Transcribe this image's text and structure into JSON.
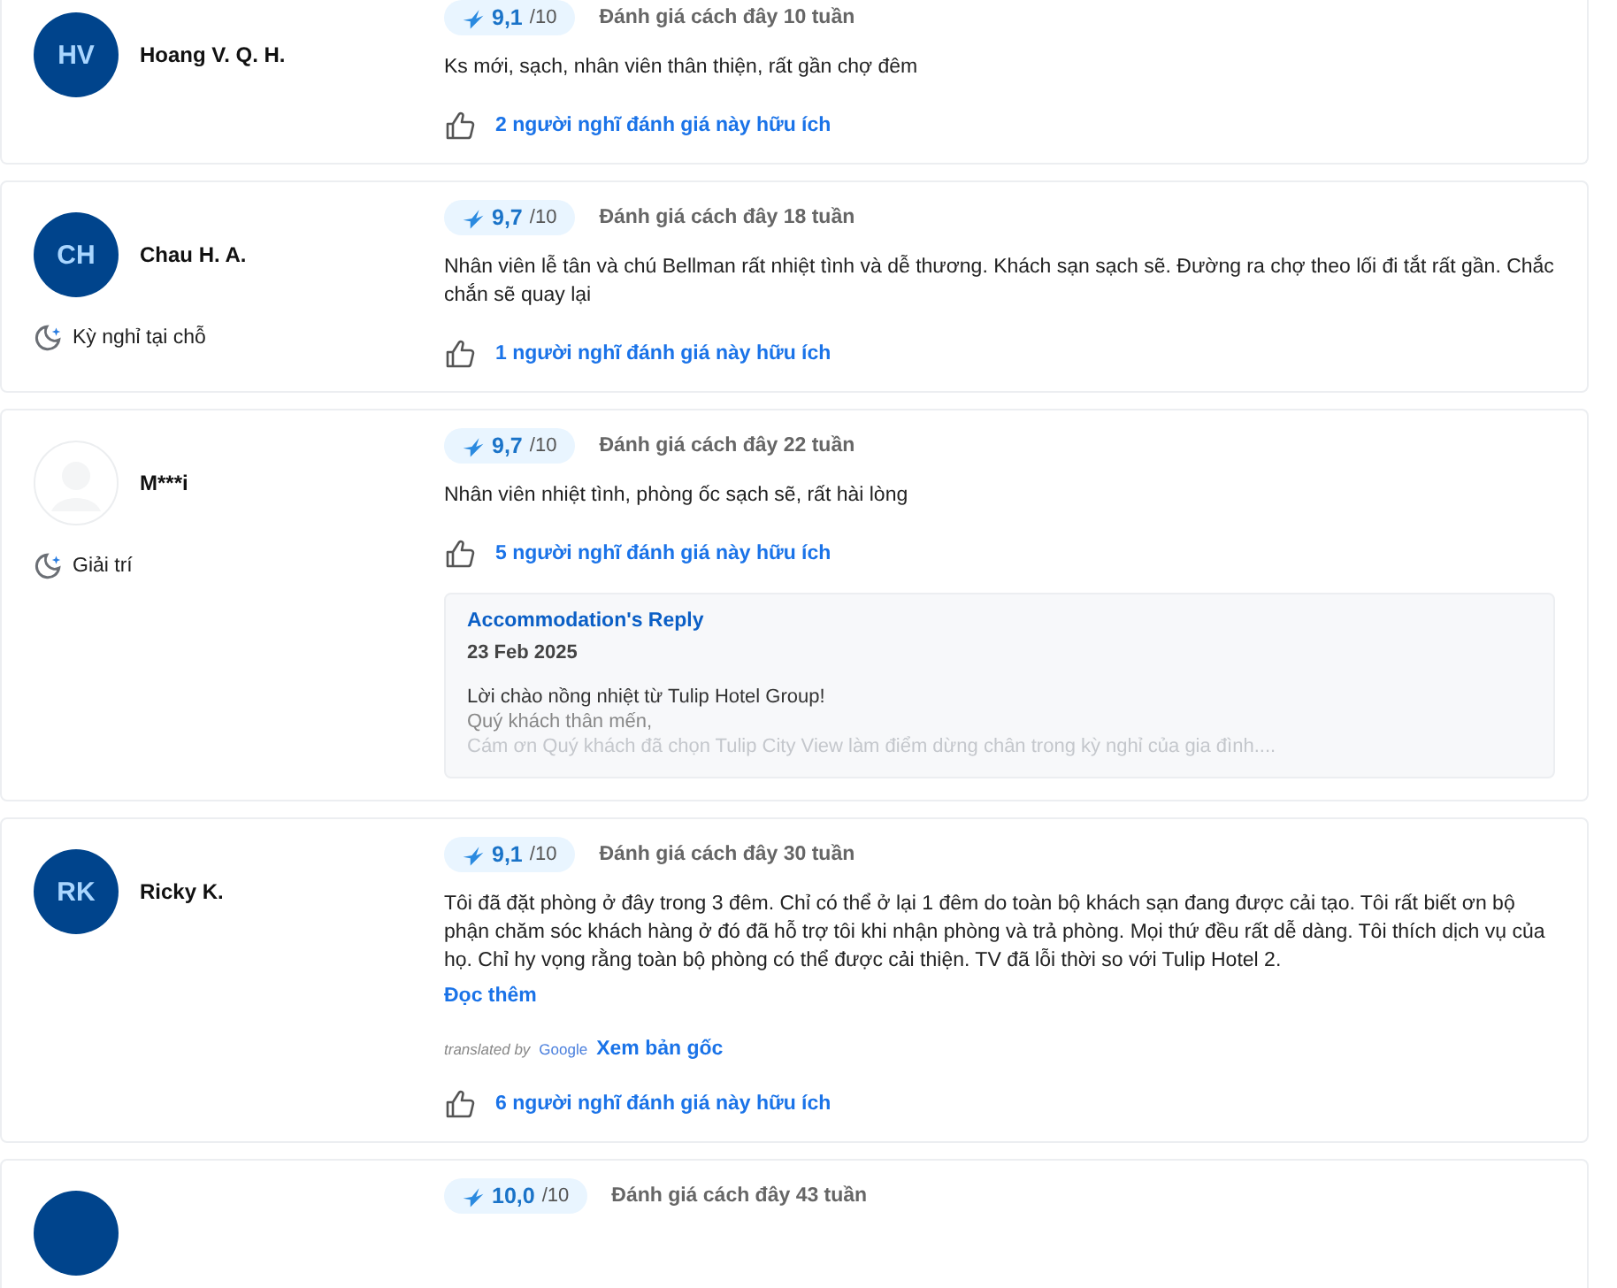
{
  "reviews": [
    {
      "avatar": {
        "kind": "initials",
        "initials": "HV"
      },
      "name": "Hoang V. Q. H.",
      "score": "9,1",
      "out_of": "/10",
      "date": "Đánh giá cách đây 10 tuần",
      "text": "Ks mới, sạch, nhân viên thân thiện, rất gần chợ đêm",
      "helpful": "2 người nghĩ đánh giá này hữu ích"
    },
    {
      "avatar": {
        "kind": "initials",
        "initials": "CH"
      },
      "name": "Chau H. A.",
      "trip_type": "Kỳ nghỉ tại chỗ",
      "score": "9,7",
      "out_of": "/10",
      "date": "Đánh giá cách đây 18 tuần",
      "text": "Nhân viên lễ tân và chú Bellman rất nhiệt tình và dễ thương. Khách sạn sạch sẽ. Đường ra chợ theo lối đi tắt rất gần. Chắc chắn sẽ quay lại",
      "helpful": "1 người nghĩ đánh giá này hữu ích"
    },
    {
      "avatar": {
        "kind": "placeholder"
      },
      "name": "M***i",
      "trip_type": "Giải trí",
      "score": "9,7",
      "out_of": "/10",
      "date": "Đánh giá cách đây 22 tuần",
      "text": "Nhân viên nhiệt tình, phòng ốc sạch sẽ, rất hài lòng",
      "helpful": "5 người nghĩ đánh giá này hữu ích",
      "reply": {
        "title": "Accommodation's Reply",
        "date": "23 Feb 2025",
        "lines": [
          "Lời chào nồng nhiệt từ Tulip Hotel Group!",
          "Quý khách  thân mến,",
          "Cám ơn Quý khách đã chọn Tulip City View làm điểm dừng chân trong kỳ nghỉ của gia đình...."
        ]
      }
    },
    {
      "avatar": {
        "kind": "initials",
        "initials": "RK"
      },
      "name": "Ricky K.",
      "score": "9,1",
      "out_of": "/10",
      "date": "Đánh giá cách đây 30 tuần",
      "text": "Tôi đã đặt phòng ở đây trong 3 đêm. Chỉ có thể ở lại 1 đêm do toàn bộ khách sạn đang được cải tạo. Tôi rất biết ơn bộ phận chăm sóc khách hàng ở đó đã hỗ trợ tôi khi nhận phòng và trả phòng. Mọi thứ đều rất dễ dàng. Tôi thích dịch vụ của họ. Chỉ hy vọng rằng toàn bộ phòng có thể được cải thiện. TV đã lỗi thời so với Tulip Hotel 2.",
      "read_more": "Đọc thêm",
      "translation": {
        "label": "translated by",
        "brand": "Google",
        "link": "Xem bản gốc"
      },
      "helpful": "6 người nghĩ đánh giá này hữu ích"
    },
    {
      "avatar": {
        "kind": "blank"
      },
      "score": "10,0",
      "out_of": "/10",
      "date": "Đánh giá cách đây 43 tuần"
    }
  ]
}
